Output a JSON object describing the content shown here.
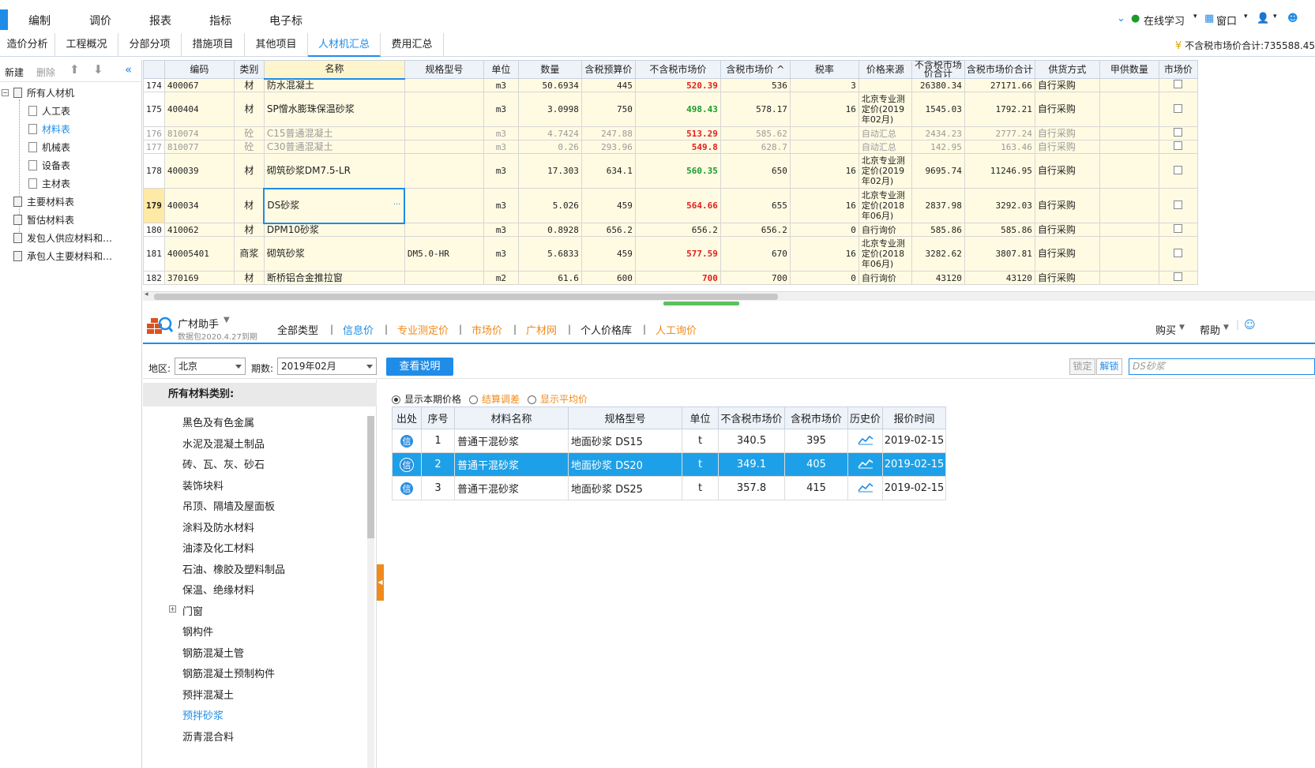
{
  "menu": {
    "items": [
      "编制",
      "调价",
      "报表",
      "指标",
      "电子标"
    ],
    "online_learning": "在线学习",
    "window": "窗口"
  },
  "tabs": [
    "造价分析",
    "工程概况",
    "分部分项",
    "措施项目",
    "其他项目",
    "人材机汇总",
    "费用汇总"
  ],
  "active_tab": "人材机汇总",
  "total_label": "不含税市场价合计:735588.45",
  "left": {
    "new": "新建",
    "delete": "删除",
    "tree": [
      {
        "label": "所有人材机"
      },
      {
        "label": "人工表"
      },
      {
        "label": "材料表"
      },
      {
        "label": "机械表"
      },
      {
        "label": "设备表"
      },
      {
        "label": "主材表"
      },
      {
        "label": "主要材料表"
      },
      {
        "label": "暂估材料表"
      },
      {
        "label": "发包人供应材料和…"
      },
      {
        "label": "承包人主要材料和…"
      }
    ]
  },
  "grid": {
    "headers": [
      "编码",
      "类别",
      "名称",
      "规格型号",
      "单位",
      "数量",
      "含税预算价",
      "不含税市场价",
      "含税市场价",
      "税率",
      "价格来源",
      "不含税市场价合计",
      "含税市场价合计",
      "供货方式",
      "甲供数量",
      "市场价"
    ],
    "rows": [
      {
        "no": "174",
        "code": "400067",
        "cat": "材",
        "name": "防水混凝土",
        "spec": "",
        "unit": "m3",
        "qty": "50.6934",
        "budget": "445",
        "mkt": "520.39",
        "mkt_tax": "536",
        "rate": "3",
        "source": "",
        "total": "26380.34",
        "total_tax": "27171.66",
        "supply": "自行采购",
        "color": "red"
      },
      {
        "no": "175",
        "code": "400404",
        "cat": "材",
        "name": "SP憎水膨珠保温砂浆",
        "spec": "",
        "unit": "m3",
        "qty": "3.0998",
        "budget": "750",
        "mkt": "498.43",
        "mkt_tax": "578.17",
        "rate": "16",
        "source": "北京专业测定价(2019年02月)",
        "total": "1545.03",
        "total_tax": "1792.21",
        "supply": "自行采购",
        "color": "green"
      },
      {
        "no": "176",
        "code": "810074",
        "cat": "砼",
        "name": "C15普通混凝土",
        "spec": "",
        "unit": "m3",
        "qty": "4.7424",
        "budget": "247.88",
        "mkt": "513.29",
        "mkt_tax": "585.62",
        "rate": "",
        "source": "自动汇总",
        "total": "2434.23",
        "total_tax": "2777.24",
        "supply": "自行采购",
        "color": "red",
        "gray": true
      },
      {
        "no": "177",
        "code": "810077",
        "cat": "砼",
        "name": "C30普通混凝土",
        "spec": "",
        "unit": "m3",
        "qty": "0.26",
        "budget": "293.96",
        "mkt": "549.8",
        "mkt_tax": "628.7",
        "rate": "",
        "source": "自动汇总",
        "total": "142.95",
        "total_tax": "163.46",
        "supply": "自行采购",
        "color": "red",
        "gray": true
      },
      {
        "no": "178",
        "code": "400039",
        "cat": "材",
        "name": "砌筑砂浆DM7.5-LR",
        "spec": "",
        "unit": "m3",
        "qty": "17.303",
        "budget": "634.1",
        "mkt": "560.35",
        "mkt_tax": "650",
        "rate": "16",
        "source": "北京专业测定价(2019年02月)",
        "total": "9695.74",
        "total_tax": "11246.95",
        "supply": "自行采购",
        "color": "green"
      },
      {
        "no": "179",
        "code": "400034",
        "cat": "材",
        "name": "DS砂浆",
        "spec": "",
        "unit": "m3",
        "qty": "5.026",
        "budget": "459",
        "mkt": "564.66",
        "mkt_tax": "655",
        "rate": "16",
        "source": "北京专业测定价(2018年06月)",
        "total": "2837.98",
        "total_tax": "3292.03",
        "supply": "自行采购",
        "color": "red",
        "selected": true
      },
      {
        "no": "180",
        "code": "410062",
        "cat": "材",
        "name": "DPM10砂浆",
        "spec": "",
        "unit": "m3",
        "qty": "0.8928",
        "budget": "656.2",
        "mkt": "656.2",
        "mkt_tax": "656.2",
        "rate": "0",
        "source": "自行询价",
        "total": "585.86",
        "total_tax": "585.86",
        "supply": "自行采购",
        "color": ""
      },
      {
        "no": "181",
        "code": "40005401",
        "cat": "商浆",
        "name": "砌筑砂浆",
        "spec": "DM5.0-HR",
        "unit": "m3",
        "qty": "5.6833",
        "budget": "459",
        "mkt": "577.59",
        "mkt_tax": "670",
        "rate": "16",
        "source": "北京专业测定价(2018年06月)",
        "total": "3282.62",
        "total_tax": "3807.81",
        "supply": "自行采购",
        "color": "red"
      },
      {
        "no": "182",
        "code": "370169",
        "cat": "材",
        "name": "断桥铝合金推拉窗",
        "spec": "",
        "unit": "m2",
        "qty": "61.6",
        "budget": "600",
        "mkt": "700",
        "mkt_tax": "700",
        "rate": "0",
        "source": "自行询价",
        "total": "43120",
        "total_tax": "43120",
        "supply": "自行采购",
        "color": "red"
      }
    ]
  },
  "assist": {
    "title": "广材助手",
    "subtitle": "数据包2020.4.27到期",
    "tabs": [
      "全部类型",
      "信息价",
      "专业测定价",
      "市场价",
      "广材网",
      "个人价格库",
      "人工询价"
    ],
    "active_tab": "信息价",
    "buy": "购买",
    "help": "帮助"
  },
  "filter": {
    "region_label": "地区:",
    "region": "北京",
    "period_label": "期数:",
    "period": "2019年02月",
    "explain_btn": "查看说明",
    "lock": "锁定",
    "unlock": "解锁",
    "search_placeholder": "DS砂浆"
  },
  "categories": {
    "header": "所有材料类别:",
    "items": [
      "黑色及有色金属",
      "水泥及混凝土制品",
      "砖、瓦、灰、砂石",
      "装饰块料",
      "吊顶、隔墙及屋面板",
      "涂料及防水材料",
      "油漆及化工材料",
      "石油、橡胶及塑料制品",
      "保温、绝缘材料",
      "门窗",
      "钢构件",
      "钢筋混凝土管",
      "钢筋混凝土预制构件",
      "预拌混凝土",
      "预拌砂浆",
      "沥青混合料"
    ],
    "active": "预拌砂浆"
  },
  "results": {
    "radios": [
      "显示本期价格",
      "结算调差",
      "显示平均价"
    ],
    "headers": [
      "出处",
      "序号",
      "材料名称",
      "规格型号",
      "单位",
      "不含税市场价",
      "含税市场价",
      "历史价",
      "报价时间"
    ],
    "badge": "信",
    "rows": [
      {
        "no": "1",
        "name": "普通干混砂浆",
        "spec": "地面砂浆 DS15",
        "unit": "t",
        "price": "340.5",
        "price_tax": "395",
        "date": "2019-02-15"
      },
      {
        "no": "2",
        "name": "普通干混砂浆",
        "spec": "地面砂浆 DS20",
        "unit": "t",
        "price": "349.1",
        "price_tax": "405",
        "date": "2019-02-15",
        "selected": true
      },
      {
        "no": "3",
        "name": "普通干混砂浆",
        "spec": "地面砂浆 DS25",
        "unit": "t",
        "price": "357.8",
        "price_tax": "415",
        "date": "2019-02-15"
      }
    ]
  },
  "colors": {
    "accent": "#1f8ce8",
    "selected_row": "#1ea0e8",
    "orange": "#f08a1c",
    "red_price": "#e02020",
    "green_price": "#1a9b2a"
  }
}
